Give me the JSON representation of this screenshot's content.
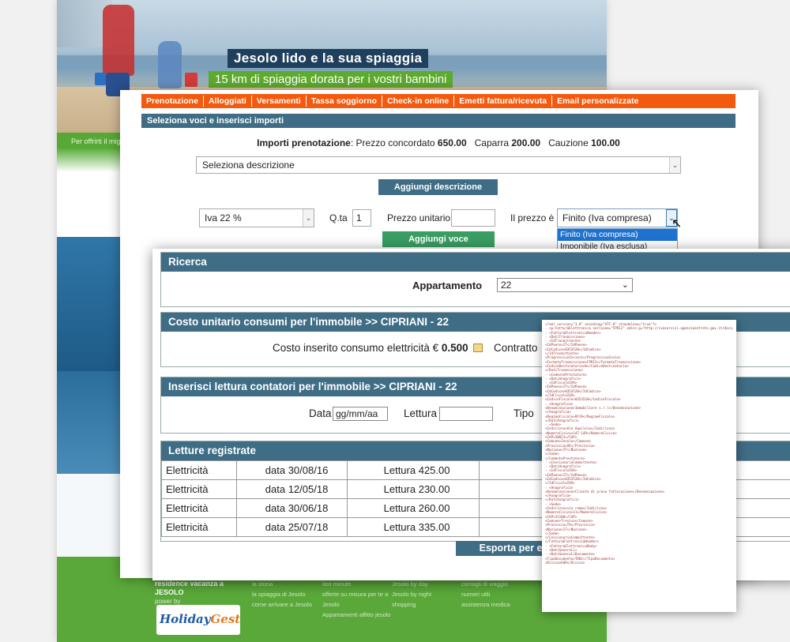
{
  "site": {
    "hero_title": "Jesolo lido e la sua spiaggia",
    "hero_subtitle": "15 km di spiaggia dorata per i vostri bambini",
    "strip_text": "Per offrirti il mig",
    "footer": {
      "brand_line1": "residence vacanza a",
      "brand_line2": "JESOLO",
      "power_by": "power by",
      "logo_holiday": "Holiday",
      "logo_gest": "Gest",
      "col1": [
        "la storia",
        "la spiaggia di Jesolo",
        "come arrivare a Jesolo"
      ],
      "col2": [
        "last minute",
        "offerte su misura per te a",
        "Jesolo",
        "Appartamenti affitto jesolo"
      ],
      "col3": [
        "Jesolo by day",
        "Jesolo by night",
        "shopping"
      ],
      "col4": [
        "consigli di viaggio",
        "numeri utili",
        "assistenza medica"
      ]
    }
  },
  "booking": {
    "tabs": [
      "Prenotazione",
      "Alloggiati",
      "Versamenti",
      "Tassa soggiorno",
      "Check-in online",
      "Emetti fattura/ricevuta",
      "Email personalizzate"
    ],
    "header": "Seleziona voci e inserisci importi",
    "importi_label": "Importi prenotazione",
    "prezzo_label": "Prezzo concordato",
    "prezzo_value": "650.00",
    "caparra_label": "Caparra",
    "caparra_value": "200.00",
    "cauzione_label": "Cauzione",
    "cauzione_value": "100.00",
    "select_descrizione": "Seleziona descrizione",
    "btn_aggiungi_descrizione": "Aggiungi descrizione",
    "iva_value": "Iva 22 %",
    "qta_label": "Q.ta",
    "qta_value": "1",
    "prezzo_unitario_label": "Prezzo unitario",
    "prezzo_e_label": "Il prezzo è",
    "prezzo_e_value": "Finito (Iva compresa)",
    "dropdown_options": [
      "Finito (Iva compresa)",
      "Imponibile (Iva esclusa)"
    ],
    "btn_aggiungi_voce": "Aggiungi voce"
  },
  "ricerca": {
    "header": "Ricerca",
    "appartamento_label": "Appartamento",
    "appartamento_value": "22",
    "costo_header": "Costo unitario consumi per l'immobile >> CIPRIANI - 22",
    "costo_label": "Costo inserito consumo elettricità €",
    "costo_value": "0.500",
    "contratto_label": "Contratto",
    "lettura_header": "Inserisci lettura contatori per l'immobile >> CIPRIANI - 22",
    "data_label": "Data",
    "data_placeholder": "gg/mm/aa",
    "lettura_label": "Lettura",
    "tipo_label": "Tipo",
    "letture_header": "Letture registrate",
    "letture": [
      {
        "tipo": "Elettricità",
        "data": "data 30/08/16",
        "lettura": "Lettura 425.00"
      },
      {
        "tipo": "Elettricità",
        "data": "data 12/05/18",
        "lettura": "Lettura 230.00"
      },
      {
        "tipo": "Elettricità",
        "data": "data 30/06/18",
        "lettura": "Lettura 260.00"
      },
      {
        "tipo": "Elettricità",
        "data": "data 25/07/18",
        "lettura": "Lettura 335.00"
      }
    ],
    "btn_esporta": "Esporta per exce"
  },
  "xml_lines": [
    "<?xml version=\"1.0\" encoding=\"UTF-8\" standalone=\"true\"?>",
    "- <p:FatturaElettronica versione=\"FPR12\" xmlns:p=\"http://ivaservizi.agenziaentrate.gov.it/docs/xsd/fatture/v1.2\">",
    "  - <FatturaElettronicaHeader>",
    "    - <DatiTrasmissione>",
    "      - <IdTrasmittente>",
    "          <IdPaese>IT</IdPaese>",
    "          <IdCodice>0353520</IdCodice>",
    "        </IdTrasmittente>",
    "        <ProgressivoInvio>1</ProgressivoInvio>",
    "        <FormatoTrasmissione>FPR12</FormatoTrasmissione>",
    "        <CodiceDestinatario>0</CodiceDestinatario>",
    "      </DatiTrasmissione>",
    "    - <CedentePrestatore>",
    "      - <DatiAnagrafici>",
    "        - <IdFiscaleIVA>",
    "            <IdPaese>IT</IdPaese>",
    "            <IdCodice>0353520</IdCodice>",
    "          </IdFiscaleIVA>",
    "          <CodiceFiscale>0353520</CodiceFiscale>",
    "        - <Anagrafica>",
    "            <Denominazione>Immobiliare        s.r.l</Denominazione>",
    "          </Anagrafica>",
    "          <RegimeFiscale>RF19</RegimeFiscale>",
    "        </DatiAnagrafici>",
    "      - <Sede>",
    "          <Indirizzo>Via Aquileia</Indirizzo>",
    "          <NumeroCivico>147-149</NumeroCivico>",
    "          <CAP>30021</CAP>",
    "          <Comune>Jesolo</Comune>",
    "          <Provincia>VE</Provincia>",
    "          <Nazione>IT</Nazione>",
    "        </Sede>",
    "      </CedentePrestatore>",
    "    - <CessionarioCommittente>",
    "      - <DatiAnagrafici>",
    "        - <IdFiscaleIVA>",
    "            <IdPaese>IT</IdPaese>",
    "            <IdCodice>0353520</IdCodice>",
    "          </IdFiscaleIVA>",
    "        - <Anagrafica>",
    "            <Denominazione>Cliente di prova fatturazione</Denominazione>",
    "          </Anagrafica>",
    "        </DatiAnagrafici>",
    "      - <Sede>",
    "          <Indirizzo>via roma</Indirizzo>",
    "          <NumeroCivico>11</NumeroCivico>",
    "          <CAP>31100</CAP>",
    "          <Comune>Treviso</Comune>",
    "          <Provincia>TV</Provincia>",
    "          <Nazione>IT</Nazione>",
    "        </Sede>",
    "      </CessionarioCommittente>",
    "    </FatturaElettronicaHeader>",
    "  - <FatturaElettronicaBody>",
    "    - <DatiGenerali>",
    "      - <DatiGeneraliDocumento>",
    "          <TipoDocumento>TD01</TipoDocumento>",
    "          <Divisa>EUR</Divisa>"
  ]
}
